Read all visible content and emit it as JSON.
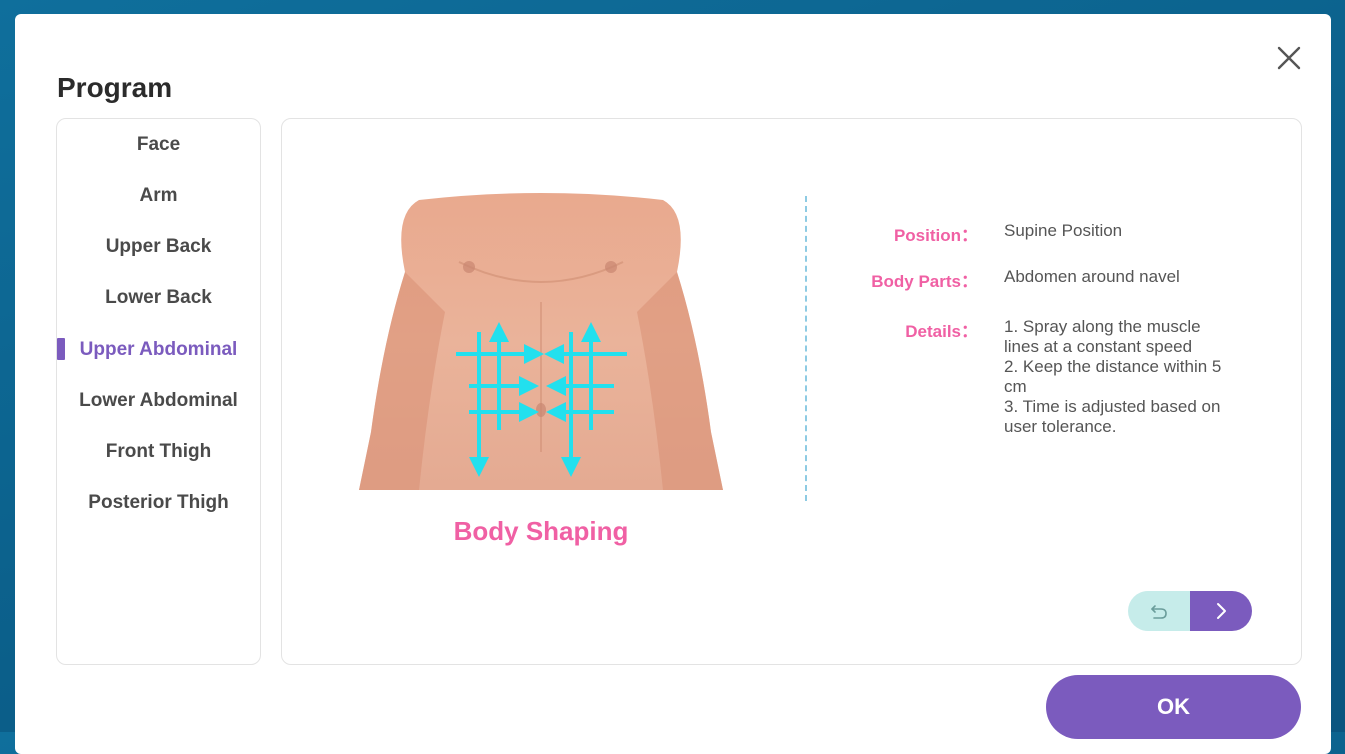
{
  "title": "Program",
  "close_icon": "close-icon",
  "sidebar": {
    "items": [
      {
        "label": "Face",
        "active": false
      },
      {
        "label": "Arm",
        "active": false
      },
      {
        "label": "Upper Back",
        "active": false
      },
      {
        "label": "Lower Back",
        "active": false
      },
      {
        "label": "Upper Abdominal",
        "active": true
      },
      {
        "label": "Lower Abdominal",
        "active": false
      },
      {
        "label": "Front Thigh",
        "active": false
      },
      {
        "label": "Posterior Thigh",
        "active": false
      }
    ]
  },
  "main": {
    "image_caption": "Body Shaping",
    "info": {
      "position_label": "Position：",
      "position_value": "Supine Position",
      "body_parts_label": "Body Parts：",
      "body_parts_value": "Abdomen around navel",
      "details_label": "Details：",
      "details_lines": [
        "1. Spray along the muscle",
        "lines at a constant speed",
        "2. Keep the distance within 5",
        "cm",
        "3. Time is adjusted based on",
        "user tolerance."
      ]
    },
    "nav": {
      "back_icon": "undo-icon",
      "next_icon": "chevron-right-icon"
    }
  },
  "footer": {
    "ok_label": "OK"
  },
  "colors": {
    "accent": "#7b5bbe",
    "pink": "#f060a4",
    "arrow": "#22e0ee",
    "back_bg": "#c6ecea"
  }
}
